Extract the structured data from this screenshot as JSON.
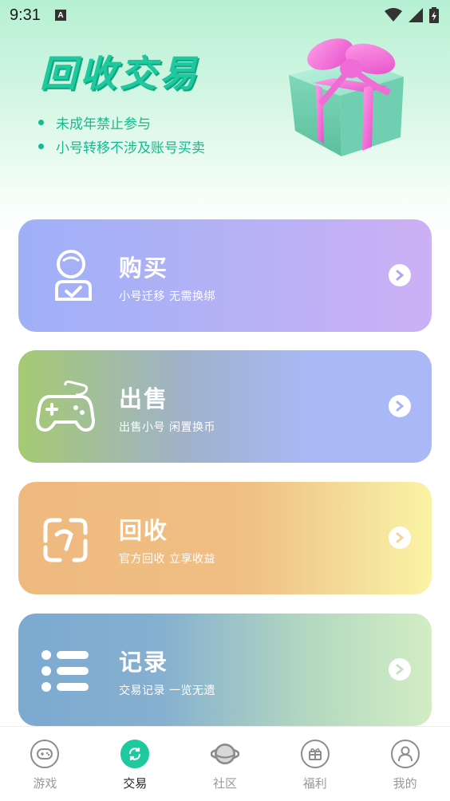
{
  "status_bar": {
    "time": "9:31",
    "notification_icon": "A"
  },
  "header": {
    "title": "回收交易",
    "bullets": [
      "未成年禁止参与",
      "小号转移不涉及账号买卖"
    ]
  },
  "cards": [
    {
      "title": "购买",
      "subtitle": "小号迁移 无需换绑",
      "icon": "user-check-icon"
    },
    {
      "title": "出售",
      "subtitle": "出售小号 闲置换币",
      "icon": "gamepad-icon"
    },
    {
      "title": "回收",
      "subtitle": "官方回收 立享收益",
      "icon": "recycle-icon"
    },
    {
      "title": "记录",
      "subtitle": "交易记录 一览无遗",
      "icon": "list-icon"
    }
  ],
  "bottom_nav": {
    "items": [
      {
        "label": "游戏",
        "icon": "gamepad-icon",
        "active": false
      },
      {
        "label": "交易",
        "icon": "exchange-icon",
        "active": true
      },
      {
        "label": "社区",
        "icon": "planet-icon",
        "active": false
      },
      {
        "label": "福利",
        "icon": "gift-icon",
        "active": false
      },
      {
        "label": "我的",
        "icon": "profile-icon",
        "active": false
      }
    ]
  },
  "colors": {
    "accent": "#1fc9a0",
    "header_bg": "#b6f0d2"
  }
}
